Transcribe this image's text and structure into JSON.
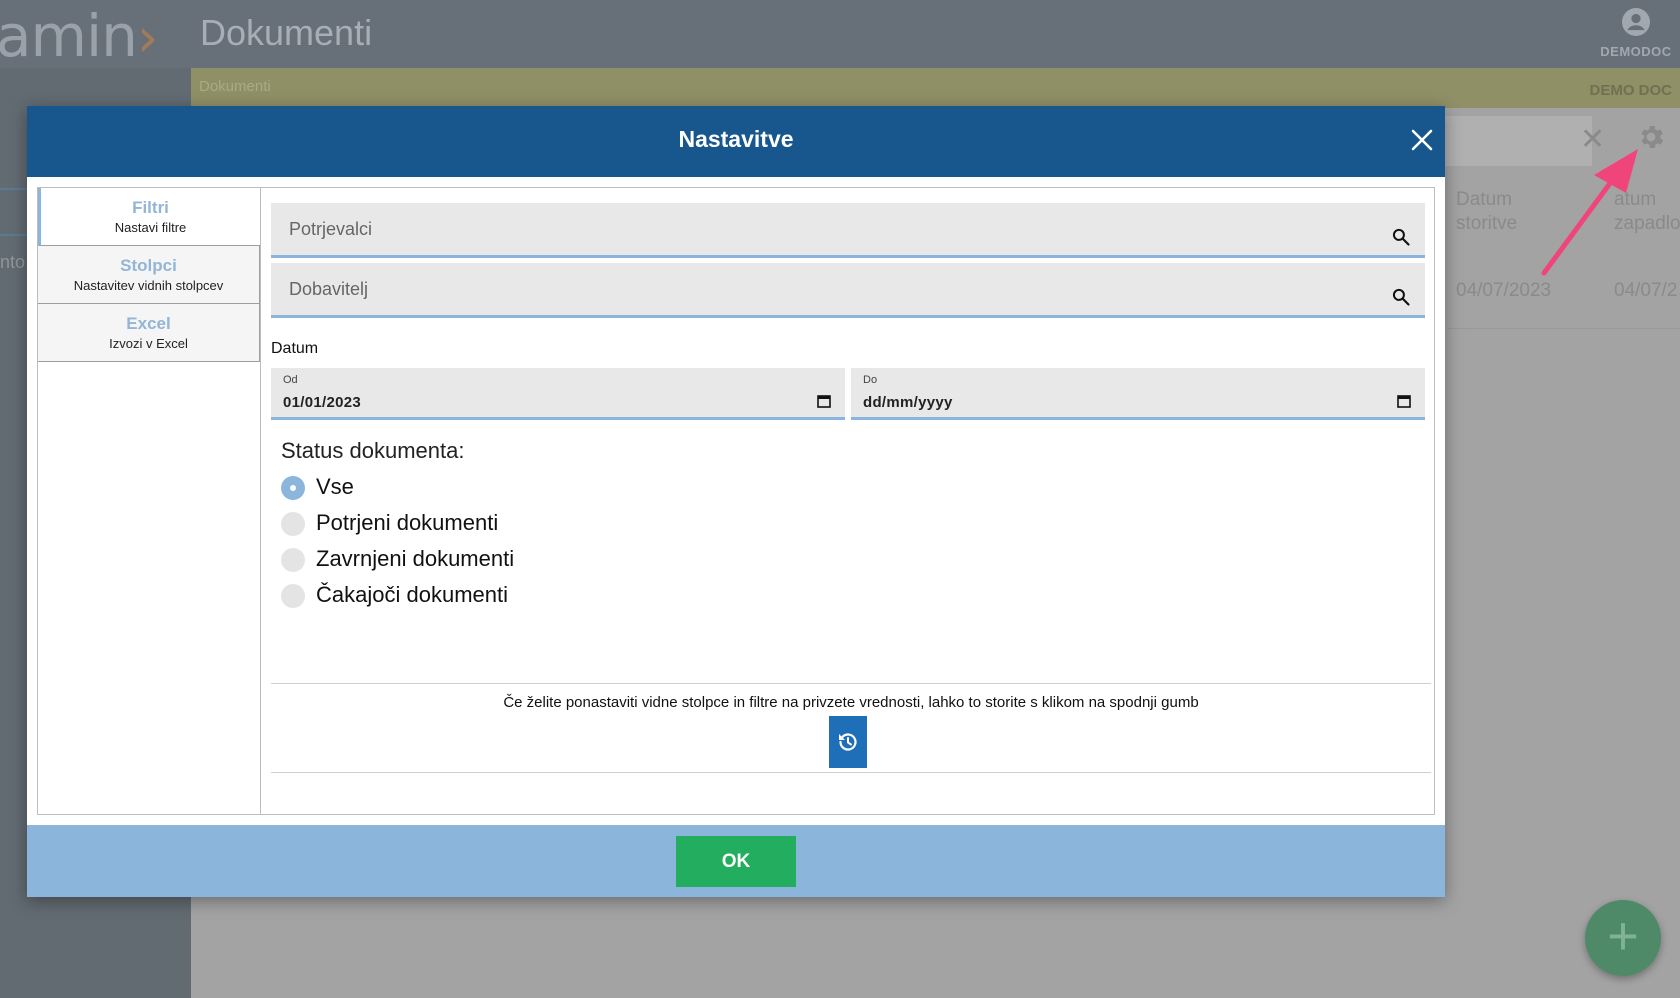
{
  "app": {
    "logo_text": "amin",
    "logo_chevron": "›",
    "title": "Dokumenti",
    "user_name": "DEMODOC",
    "breadcrumb": "Dokumenti",
    "company": "DEMO DOC",
    "sidebar_fragment": "nto",
    "fab_label": "+"
  },
  "table": {
    "columns": [
      {
        "line1": "Datum",
        "line2": "storitve"
      },
      {
        "line1": "atum",
        "line2": "zapadlo"
      }
    ],
    "row": [
      "04/07/2023",
      "04/07/2"
    ]
  },
  "modal": {
    "title": "Nastavitve",
    "tabs": [
      {
        "title": "Filtri",
        "subtitle": "Nastavi filtre"
      },
      {
        "title": "Stolpci",
        "subtitle": "Nastavitev vidnih stolpcev"
      },
      {
        "title": "Excel",
        "subtitle": "Izvozi v Excel"
      }
    ],
    "filters": {
      "applicants_placeholder": "Potrjevalci",
      "supplier_placeholder": "Dobavitelj",
      "date_section": "Datum",
      "date_from_label": "Od",
      "date_from_value": "01/01/2023",
      "date_to_label": "Do",
      "date_to_value": "dd/mm/yyyy",
      "status_title": "Status dokumenta:",
      "status_options": [
        "Vse",
        "Potrjeni dokumenti",
        "Zavrnjeni dokumenti",
        "Čakajoči dokumenti"
      ],
      "status_selected": "Vse",
      "reset_text": "Če želite ponastaviti vidne stolpce in filtre na privzete vrednosti, lahko to storite s klikom na spodnji gumb"
    },
    "ok_label": "OK"
  },
  "colors": {
    "modal_header": "#17578d",
    "accent_light": "#8bb5db",
    "ok_green": "#22ae5e",
    "reset_blue": "#1f6fb8",
    "annotation_arrow": "#f0457a"
  }
}
